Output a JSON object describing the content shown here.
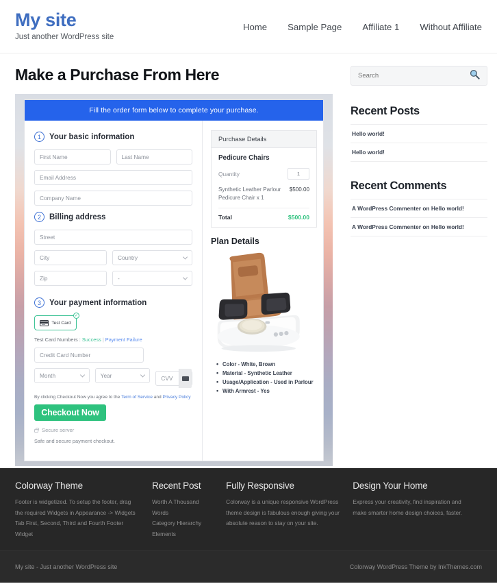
{
  "header": {
    "site_title": "My site",
    "tagline": "Just another WordPress site",
    "nav": [
      {
        "label": "Home"
      },
      {
        "label": "Sample Page"
      },
      {
        "label": "Affiliate 1"
      },
      {
        "label": "Without Affiliate"
      }
    ]
  },
  "main": {
    "page_title": "Make a Purchase From Here",
    "form_banner": "Fill the order form below to complete your purchase.",
    "steps": {
      "one": {
        "num": "1",
        "label": "Your basic information"
      },
      "two": {
        "num": "2",
        "label": "Billing address"
      },
      "three": {
        "num": "3",
        "label": "Your payment information"
      }
    },
    "fields": {
      "first_name": "First Name",
      "last_name": "Last Name",
      "email": "Email Address",
      "company": "Company Name",
      "street": "Street",
      "city": "City",
      "country": "Country",
      "zip": "Zip",
      "state": "-",
      "card_number": "Credit Card Number",
      "month": "Month",
      "year": "Year",
      "cvv": "CVV"
    },
    "payment": {
      "test_card_label": "Test Card",
      "test_numbers_prefix": "Test Card Numbers : ",
      "success_link": "Success",
      "separator": " | ",
      "failure_link": "Payment Failure",
      "terms_prefix": "By clicking Checkout Now you agree to the ",
      "terms_link": "Term of Service",
      "terms_mid": " and ",
      "privacy_link": "Privacy Policy",
      "checkout_label": "Checkout Now",
      "secure_server": "Secure server",
      "safe_note": "Safe and secure payment checkout."
    },
    "purchase_details": {
      "heading": "Purchase Details",
      "product": "Pedicure Chairs",
      "quantity_label": "Quantity",
      "quantity_value": "1",
      "line_item": "Synthetic Leather Parlour Pedicure Chair x 1",
      "line_price": "$500.00",
      "total_label": "Total",
      "total_amount": "$500.00"
    },
    "plan": {
      "title": "Plan Details",
      "features": [
        "Color - White, Brown",
        "Material - Synthetic Leather",
        "Usage/Application - Used in Parlour",
        "With Armrest - Yes"
      ]
    }
  },
  "sidebar": {
    "search_placeholder": "Search",
    "recent_posts": {
      "title": "Recent Posts",
      "items": [
        "Hello world!",
        "Hello world!"
      ]
    },
    "recent_comments": {
      "title": "Recent Comments",
      "items": [
        "A WordPress Commenter on Hello world!",
        "A WordPress Commenter on Hello world!"
      ]
    }
  },
  "footer": {
    "columns": [
      {
        "title": "Colorway Theme",
        "body": "Footer is widgetized. To setup the footer, drag the required Widgets in Appearance -> Widgets Tab First, Second, Third and Fourth Footer Widget"
      },
      {
        "title": "Recent Post",
        "items": [
          "Worth A Thousand Words",
          "Category Hierarchy",
          "Elements"
        ]
      },
      {
        "title": "Fully Responsive",
        "body": "Colorway is a unique responsive WordPress theme design is fabulous enough giving your absolute reason to stay on your site."
      },
      {
        "title": "Design Your Home",
        "body": "Express your creativity, find inspiration and make smarter home design choices, faster."
      }
    ],
    "bottom_left": "My site - Just another WordPress site",
    "bottom_right": "Colorway WordPress Theme by InkThemes.com"
  },
  "colors": {
    "brand_blue": "#3f6ec0",
    "banner_blue": "#2563eb",
    "accent_green": "#2ec27e",
    "link_blue": "#4a7ddb",
    "footer_dark": "#272727"
  }
}
